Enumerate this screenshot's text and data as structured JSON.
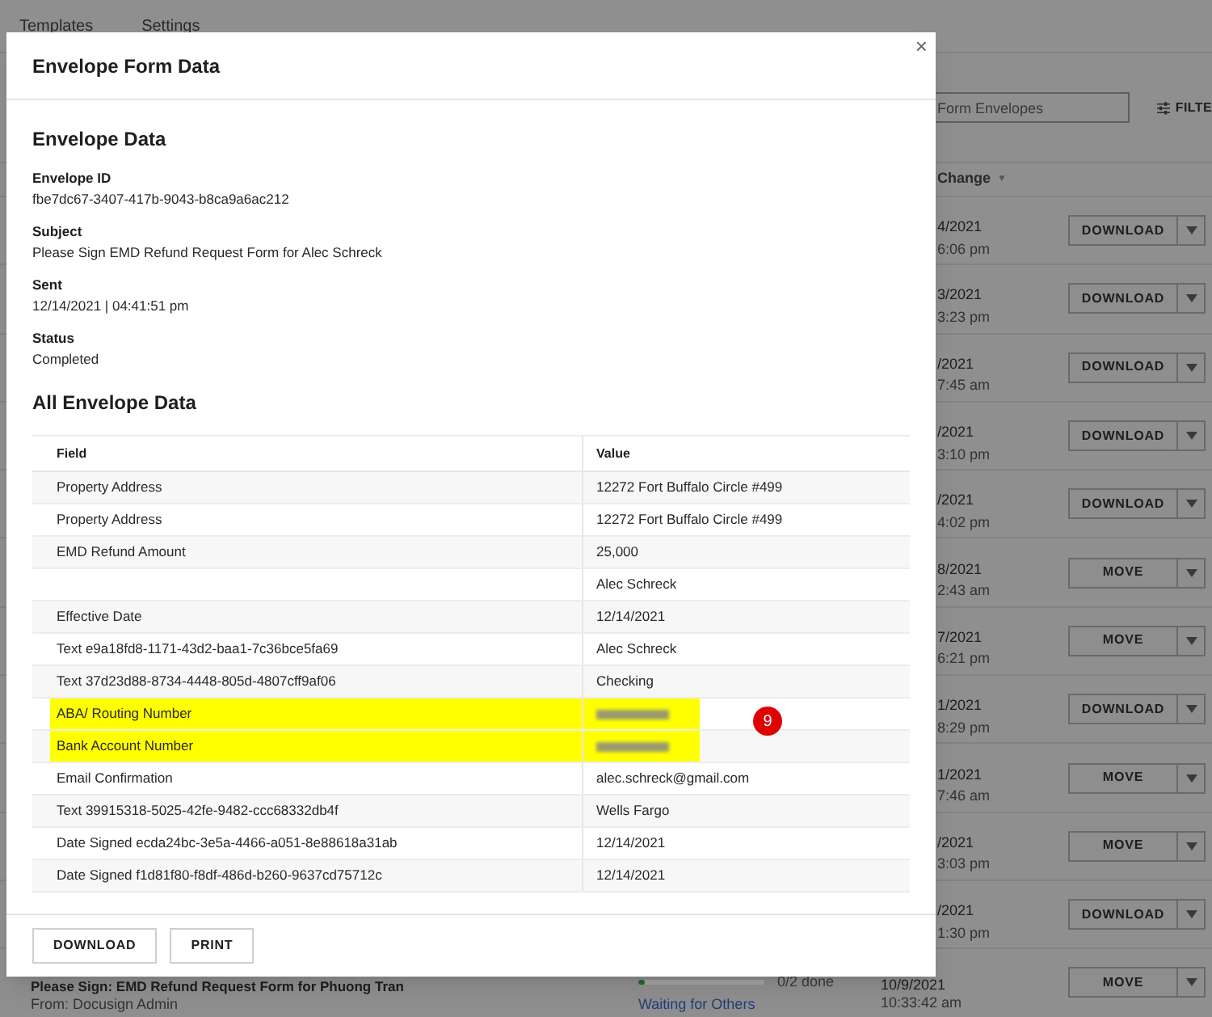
{
  "background": {
    "nav_tabs": [
      "Templates",
      "Settings"
    ],
    "search": {
      "placeholder": "Form Envelopes"
    },
    "filter_button": "FILTE",
    "column_header": "Change",
    "sort_icon": "▼",
    "rows": [
      {
        "kind": "partial",
        "date": "4/2021",
        "time": "6:06 pm",
        "action": "DOWNLOAD"
      },
      {
        "kind": "partial",
        "date": "3/2021",
        "time": "3:23 pm",
        "action": "DOWNLOAD"
      },
      {
        "kind": "partial",
        "date": "/2021",
        "time": "7:45 am",
        "action": "DOWNLOAD"
      },
      {
        "kind": "partial",
        "date": "/2021",
        "time": "3:10 pm",
        "action": "DOWNLOAD"
      },
      {
        "kind": "partial",
        "date": "/2021",
        "time": "4:02 pm",
        "action": "DOWNLOAD"
      },
      {
        "kind": "partial",
        "date": "8/2021",
        "time": "2:43 am",
        "action": "MOVE"
      },
      {
        "kind": "partial",
        "date": "7/2021",
        "time": "6:21 pm",
        "action": "MOVE"
      },
      {
        "kind": "partial",
        "date": "1/2021",
        "time": "8:29 pm",
        "action": "DOWNLOAD"
      },
      {
        "kind": "partial",
        "date": "1/2021",
        "time": "7:46 am",
        "action": "MOVE"
      },
      {
        "kind": "partial",
        "date": "/2021",
        "time": "3:03 pm",
        "action": "MOVE"
      },
      {
        "kind": "partial",
        "date": "/2021",
        "time": "1:30 pm",
        "action": "DOWNLOAD"
      },
      {
        "kind": "full",
        "subject": "Please Sign: EMD Refund Request Form for Phuong Tran",
        "from": "From: Docusign Admin",
        "level": 0.05,
        "progress": "0/2 done",
        "status": "Waiting for Others",
        "date": "10/9/2021",
        "time": "10:33:42 am",
        "action": "MOVE"
      }
    ]
  },
  "modal": {
    "title": "Envelope Form Data",
    "close": "×",
    "section_title": "Envelope Data",
    "details": [
      {
        "label": "Envelope ID",
        "value": "fbe7dc67-3407-417b-9043-b8ca9a6ac212"
      },
      {
        "label": "Subject",
        "value": "Please Sign EMD Refund Request Form for Alec Schreck"
      },
      {
        "label": "Sent",
        "value": "12/14/2021 | 04:41:51 pm"
      },
      {
        "label": "Status",
        "value": "Completed"
      }
    ],
    "table_title": "All Envelope Data",
    "table": {
      "columns": [
        "Field",
        "Value"
      ],
      "rows": [
        {
          "field": "Property Address",
          "value": "12272 Fort Buffalo Circle #499",
          "highlighted": false,
          "redacted": false
        },
        {
          "field": "Property Address",
          "value": "12272 Fort Buffalo Circle #499",
          "highlighted": false,
          "redacted": false
        },
        {
          "field": "EMD Refund Amount",
          "value": "25,000",
          "highlighted": false,
          "redacted": false
        },
        {
          "value": "Alec Schreck",
          "highlighted": false,
          "redacted": false
        },
        {
          "field": "Effective Date",
          "value": "12/14/2021",
          "highlighted": false,
          "redacted": false
        },
        {
          "field": "Text e9a18fd8-1171-43d2-baa1-7c36bce5fa69",
          "value": "Alec Schreck",
          "highlighted": false,
          "redacted": false
        },
        {
          "field": "Text 37d23d88-8734-4448-805d-4807cff9af06",
          "value": "Checking",
          "highlighted": false,
          "redacted": false
        },
        {
          "field": "ABA/ Routing Number",
          "highlighted": true,
          "redacted": true
        },
        {
          "field": "Bank Account Number",
          "highlighted": true,
          "redacted": true
        },
        {
          "field": "Email Confirmation",
          "value": "alec.schreck@gmail.com",
          "highlighted": false,
          "redacted": false
        },
        {
          "field": "Text 39915318-5025-42fe-9482-ccc68332db4f",
          "value": "Wells Fargo",
          "highlighted": false,
          "redacted": false
        },
        {
          "field": "Date Signed ecda24bc-3e5a-4466-a051-8e88618a31ab",
          "value": "12/14/2021",
          "highlighted": false,
          "redacted": false
        },
        {
          "field": "Date Signed f1d81f80-f8df-486d-b260-9637cd75712c",
          "value": "12/14/2021",
          "highlighted": false,
          "redacted": false
        }
      ]
    },
    "badge": "9",
    "buttons": [
      "DOWNLOAD",
      "PRINT"
    ]
  }
}
